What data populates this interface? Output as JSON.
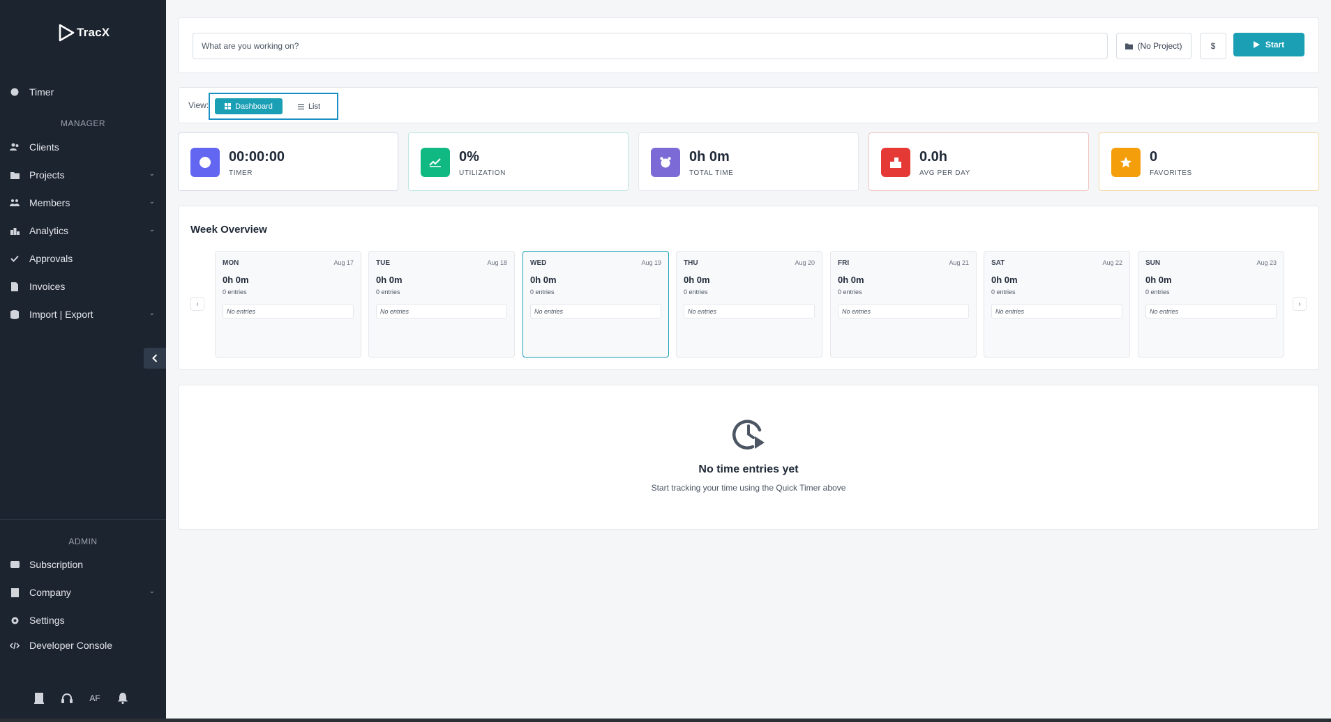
{
  "app": {
    "name": "TracX"
  },
  "sidebar": {
    "timer": "Timer",
    "manager_label": "MANAGER",
    "manager_items": [
      {
        "label": "Clients",
        "icon": "users-icon",
        "chevron": false
      },
      {
        "label": "Projects",
        "icon": "folder-icon",
        "chevron": true
      },
      {
        "label": "Members",
        "icon": "members-icon",
        "chevron": true
      },
      {
        "label": "Analytics",
        "icon": "analytics-icon",
        "chevron": true
      },
      {
        "label": "Approvals",
        "icon": "check-icon",
        "chevron": false
      },
      {
        "label": "Invoices",
        "icon": "invoice-icon",
        "chevron": false
      },
      {
        "label": "Import | Export",
        "icon": "database-icon",
        "chevron": true
      }
    ],
    "admin_label": "ADMIN",
    "admin_items": [
      {
        "label": "Subscription",
        "icon": "card-icon",
        "chevron": false
      },
      {
        "label": "Company",
        "icon": "building-icon",
        "chevron": true
      },
      {
        "label": "Settings",
        "icon": "gear-icon",
        "chevron": false
      },
      {
        "label": "Developer Console",
        "icon": "code-icon",
        "chevron": false
      }
    ],
    "footer": {
      "avatar_initials": "AF"
    }
  },
  "timer_bar": {
    "placeholder": "What are you working on?",
    "project": "(No Project)",
    "billable": "$",
    "start": "Start"
  },
  "view": {
    "label": "View:",
    "dashboard": "Dashboard",
    "list": "List"
  },
  "stats": [
    {
      "value": "00:00:00",
      "label": "TIMER",
      "color": "#6366f1"
    },
    {
      "value": "0%",
      "label": "UTILIZATION",
      "color": "#10b981"
    },
    {
      "value": "0h 0m",
      "label": "TOTAL TIME",
      "color": "#7c6bd6"
    },
    {
      "value": "0.0h",
      "label": "AVG PER DAY",
      "color": "#e53935"
    },
    {
      "value": "0",
      "label": "FAVORITES",
      "color": "#f59e0b"
    }
  ],
  "week": {
    "title": "Week Overview",
    "days": [
      {
        "name": "MON",
        "date": "Aug 17",
        "time": "0h 0m",
        "entries": "0 entries",
        "empty": "No entries"
      },
      {
        "name": "TUE",
        "date": "Aug 18",
        "time": "0h 0m",
        "entries": "0 entries",
        "empty": "No entries"
      },
      {
        "name": "WED",
        "date": "Aug 19",
        "time": "0h 0m",
        "entries": "0 entries",
        "empty": "No entries"
      },
      {
        "name": "THU",
        "date": "Aug 20",
        "time": "0h 0m",
        "entries": "0 entries",
        "empty": "No entries"
      },
      {
        "name": "FRI",
        "date": "Aug 21",
        "time": "0h 0m",
        "entries": "0 entries",
        "empty": "No entries"
      },
      {
        "name": "SAT",
        "date": "Aug 22",
        "time": "0h 0m",
        "entries": "0 entries",
        "empty": "No entries"
      },
      {
        "name": "SUN",
        "date": "Aug 23",
        "time": "0h 0m",
        "entries": "0 entries",
        "empty": "No entries"
      }
    ]
  },
  "empty_state": {
    "title": "No time entries yet",
    "subtitle": "Start tracking your time using the Quick Timer above"
  }
}
